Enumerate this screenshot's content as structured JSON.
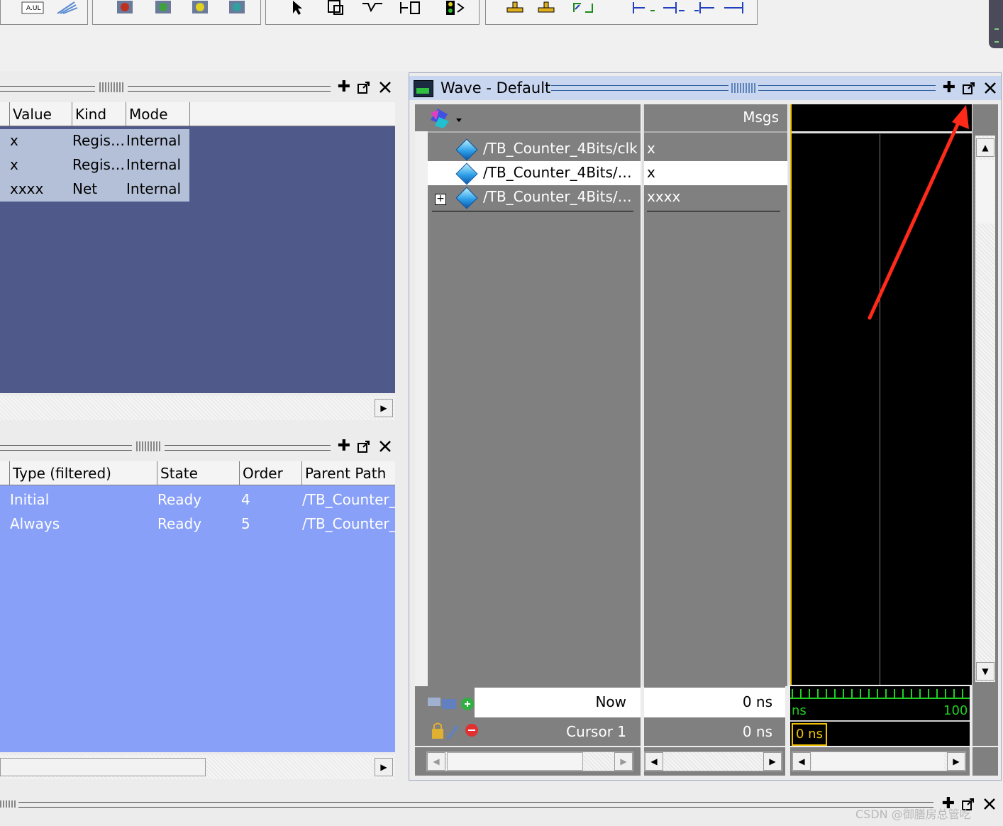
{
  "objects_pane": {
    "columns": [
      "Value",
      "Kind",
      "Mode"
    ],
    "rows": [
      {
        "value": "x",
        "kind": "Regis…",
        "mode": "Internal"
      },
      {
        "value": "x",
        "kind": "Regis…",
        "mode": "Internal"
      },
      {
        "value": "xxxx",
        "kind": "Net",
        "mode": "Internal"
      }
    ]
  },
  "processes_pane": {
    "columns": [
      "Type (filtered)",
      "State",
      "Order",
      "Parent Path"
    ],
    "rows": [
      {
        "type": "Initial",
        "state": "Ready",
        "order": "4",
        "parent": "/TB_Counter_"
      },
      {
        "type": "Always",
        "state": "Ready",
        "order": "5",
        "parent": "/TB_Counter_"
      }
    ]
  },
  "wave_pane": {
    "title": "Wave - Default",
    "msgs_header": "Msgs",
    "signals": [
      {
        "name": "/TB_Counter_4Bits/clk",
        "value": "x"
      },
      {
        "name": "/TB_Counter_4Bits/…",
        "value": "x"
      },
      {
        "name": "/TB_Counter_4Bits/…",
        "value": "xxxx"
      }
    ],
    "now_label": "Now",
    "now_value": "0 ns",
    "cursor_label": "Cursor 1",
    "cursor_value": "0 ns",
    "timeline_left": "ns",
    "timeline_right": "100",
    "cursor_box": "0 ns"
  },
  "watermark": "CSDN @御膳房总管吃",
  "colors": {
    "objects_bg": "#4f5a8a",
    "processes_bg": "#88a0f8",
    "wave_bg": "#000000",
    "wave_list_bg": "#808080",
    "annotation_arrow": "#ff2a1a",
    "timeline_green": "#22d022",
    "cursor_yellow": "#f0c000"
  },
  "icons": {
    "toolbar": [
      "sim-icon",
      "compile-icon",
      "run-icon",
      "step-icon",
      "restart-icon",
      "select-icon",
      "zoom-icon",
      "wave-icon",
      "signal-icon",
      "traffic-icon",
      "bookmark-icon",
      "find-icon",
      "cursor-prev-icon",
      "cursor-next-icon",
      "edge-icon"
    ],
    "pane_controls": [
      "dock-icon",
      "undock-icon",
      "close-icon"
    ]
  }
}
